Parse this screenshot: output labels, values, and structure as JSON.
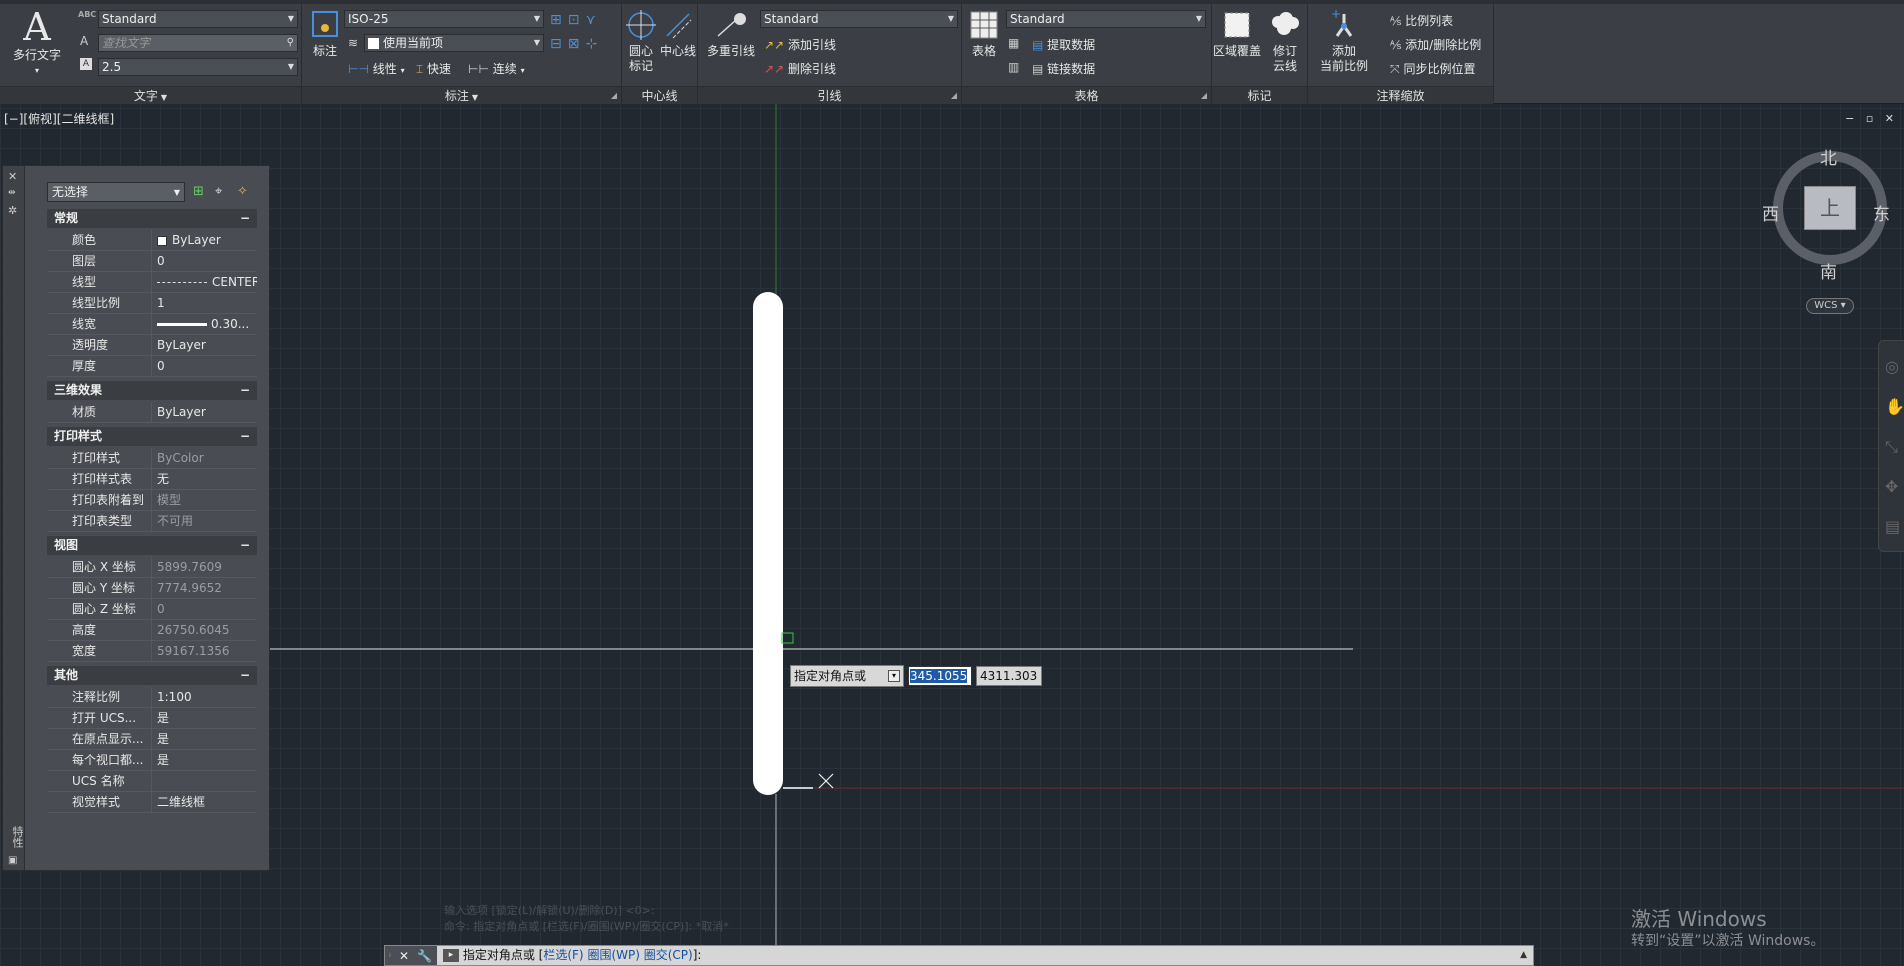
{
  "ribbon": {
    "text_panel": {
      "title": "文字",
      "mtext_label": "多行文字",
      "text_style": "Standard",
      "find_placeholder": "查找文字",
      "text_height": "2.5"
    },
    "dim_panel": {
      "title": "标注",
      "dim_label": "标注",
      "dim_style": "ISO-25",
      "dim_layer": "使用当前项",
      "linear_label": "线性",
      "quick_label": "快速",
      "continue_label": "连续"
    },
    "center_panel": {
      "title": "中心线",
      "center_mark_label": "圆心\n标记",
      "centerline_label": "中心线"
    },
    "leader_panel": {
      "title": "引线",
      "mleader_label": "多重引线",
      "mleader_style": "Standard",
      "add_leader_label": "添加引线",
      "remove_leader_label": "删除引线"
    },
    "table_panel": {
      "title": "表格",
      "table_label": "表格",
      "table_style": "Standard",
      "extract_label": "提取数据",
      "link_label": "链接数据"
    },
    "markup_panel": {
      "title": "标记",
      "wipeout_label": "区域覆盖",
      "revcloud_label": "修订\n云线"
    },
    "scale_panel": {
      "title": "注释缩放",
      "add_scale_label": "添加\n当前比例",
      "scale_list_label": "比例列表",
      "add_remove_label": "添加/删除比例",
      "sync_label": "同步比例位置"
    }
  },
  "viewport": {
    "label": "[−][俯视][二维线框]",
    "controls": "− ▫ ✕"
  },
  "properties": {
    "selection": "无选择",
    "palette_title": "特性",
    "sections": [
      {
        "name": "常规",
        "rows": [
          {
            "key": "颜色",
            "value": "ByLayer",
            "dim": false
          },
          {
            "key": "图层",
            "value": "0",
            "dim": false
          },
          {
            "key": "线型",
            "value": "CENTER",
            "dim": false
          },
          {
            "key": "线型比例",
            "value": "1",
            "dim": false
          },
          {
            "key": "线宽",
            "value": "0.30...",
            "dim": false
          },
          {
            "key": "透明度",
            "value": "ByLayer",
            "dim": false
          },
          {
            "key": "厚度",
            "value": "0",
            "dim": false
          }
        ]
      },
      {
        "name": "三维效果",
        "rows": [
          {
            "key": "材质",
            "value": "ByLayer",
            "dim": false
          }
        ]
      },
      {
        "name": "打印样式",
        "rows": [
          {
            "key": "打印样式",
            "value": "ByColor",
            "dim": true
          },
          {
            "key": "打印样式表",
            "value": "无",
            "dim": false
          },
          {
            "key": "打印表附着到",
            "value": "模型",
            "dim": true
          },
          {
            "key": "打印表类型",
            "value": "不可用",
            "dim": true
          }
        ]
      },
      {
        "name": "视图",
        "rows": [
          {
            "key": "圆心 X 坐标",
            "value": "5899.7609",
            "dim": true
          },
          {
            "key": "圆心 Y 坐标",
            "value": "7774.9652",
            "dim": true
          },
          {
            "key": "圆心 Z 坐标",
            "value": "0",
            "dim": true
          },
          {
            "key": "高度",
            "value": "26750.6045",
            "dim": true
          },
          {
            "key": "宽度",
            "value": "59167.1356",
            "dim": true
          }
        ]
      },
      {
        "name": "其他",
        "rows": [
          {
            "key": "注释比例",
            "value": "1:100",
            "dim": false
          },
          {
            "key": "打开 UCS...",
            "value": "是",
            "dim": false
          },
          {
            "key": "在原点显示...",
            "value": "是",
            "dim": false
          },
          {
            "key": "每个视口都...",
            "value": "是",
            "dim": false
          },
          {
            "key": "UCS 名称",
            "value": "",
            "dim": false
          },
          {
            "key": "视觉样式",
            "value": "二维线框",
            "dim": false
          }
        ]
      }
    ]
  },
  "dynamic_input": {
    "prompt": "指定对角点或",
    "value1": "345.1055",
    "value2": "4311.303"
  },
  "viewcube": {
    "north": "北",
    "south": "南",
    "east": "东",
    "west": "西",
    "face": "上",
    "wcs": "WCS"
  },
  "command_history": [
    "输入选项 [锁定(L)/解锁(U)/删除(D)] <0>:",
    "命令: 指定对角点或 [栏选(F)/圈围(WP)/圈交(CP)]:  *取消*"
  ],
  "command_line": {
    "prompt": "指定对角点或 [",
    "opt1": "栏选(F)",
    "opt2": "圈围(WP)",
    "opt3": "圈交(CP)",
    "tail": "]:"
  },
  "watermark": {
    "line1": "激活 Windows",
    "line2": "转到“设置”以激活 Windows。"
  }
}
